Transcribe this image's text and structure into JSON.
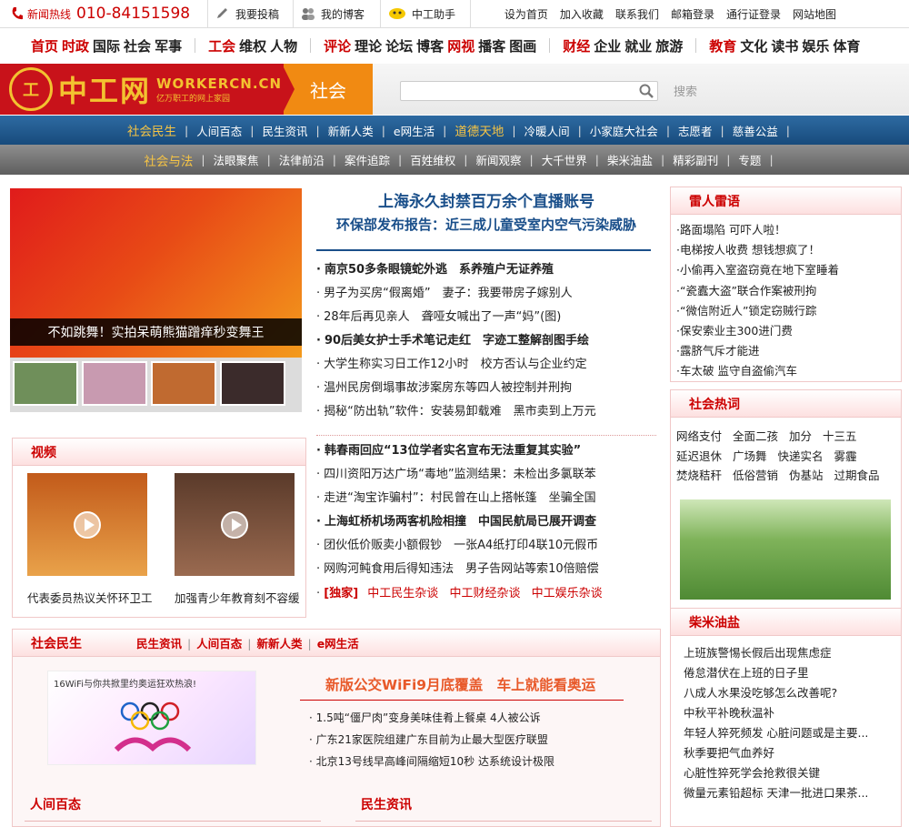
{
  "topbar": {
    "hotline_label": "新闻热线",
    "hotline_number": "010-84151598",
    "buttons": [
      {
        "label": "我要投稿",
        "icon": "pen-icon"
      },
      {
        "label": "我的博客",
        "icon": "people-icon"
      },
      {
        "label": "中工助手",
        "icon": "assistant-icon"
      }
    ],
    "links": [
      "设为首页",
      "加入收藏",
      "联系我们",
      "邮箱登录",
      "通行证登录",
      "网站地图"
    ]
  },
  "mainnav": {
    "groups": [
      [
        {
          "t": "首页",
          "red": true
        },
        {
          "t": "时政",
          "red": true
        },
        {
          "t": "国际",
          "red": false
        },
        {
          "t": "社会",
          "red": false
        },
        {
          "t": "军事",
          "red": false
        }
      ],
      [
        {
          "t": "工会",
          "red": true
        },
        {
          "t": "维权",
          "red": false
        },
        {
          "t": "人物",
          "red": false
        }
      ],
      [
        {
          "t": "评论",
          "red": true
        },
        {
          "t": "理论",
          "red": false
        },
        {
          "t": "论坛",
          "red": false
        },
        {
          "t": "博客",
          "red": false
        },
        {
          "t": "网视",
          "red": true
        },
        {
          "t": "播客",
          "red": false
        },
        {
          "t": "图画",
          "red": false
        }
      ],
      [
        {
          "t": "财经",
          "red": true
        },
        {
          "t": "企业",
          "red": false
        },
        {
          "t": "就业",
          "red": false
        },
        {
          "t": "旅游",
          "red": false
        }
      ],
      [
        {
          "t": "教育",
          "red": true
        },
        {
          "t": "文化",
          "red": false
        },
        {
          "t": "读书",
          "red": false
        },
        {
          "t": "娱乐",
          "red": false
        },
        {
          "t": "体育",
          "red": false
        }
      ]
    ]
  },
  "banner": {
    "logo_cn": "中工网",
    "logo_url": "WORKERCN.CN",
    "logo_slogan": "亿万职工的网上家园",
    "section": "社会",
    "search_placeholder": "",
    "search_button": "搜索"
  },
  "subnav1": [
    {
      "t": "社会民生",
      "hl": true
    },
    {
      "t": "人间百态",
      "hl": false
    },
    {
      "t": "民生资讯",
      "hl": false
    },
    {
      "t": "新新人类",
      "hl": false
    },
    {
      "t": "e网生活",
      "hl": false
    },
    {
      "t": "道德天地",
      "hl": true
    },
    {
      "t": "冷暖人间",
      "hl": false
    },
    {
      "t": "小家庭大社会",
      "hl": false
    },
    {
      "t": "志愿者",
      "hl": false
    },
    {
      "t": "慈善公益",
      "hl": false
    }
  ],
  "subnav2": [
    {
      "t": "社会与法",
      "hl": true
    },
    {
      "t": "法眼聚焦",
      "hl": false
    },
    {
      "t": "法律前沿",
      "hl": false
    },
    {
      "t": "案件追踪",
      "hl": false
    },
    {
      "t": "百姓维权",
      "hl": false
    },
    {
      "t": "新闻观察",
      "hl": false
    },
    {
      "t": "大千世界",
      "hl": false
    },
    {
      "t": "柴米油盐",
      "hl": false
    },
    {
      "t": "精彩副刊",
      "hl": false
    },
    {
      "t": "专题",
      "hl": false
    }
  ],
  "feature": {
    "caption": "不如跳舞！实拍呆萌熊猫蹭痒秒变舞王",
    "thumb_colors": [
      "#6f8f5a",
      "#c89ab0",
      "#c06a30",
      "#3b2b2b"
    ]
  },
  "video": {
    "title": "视频",
    "items": [
      {
        "caption": "代表委员热议关怀环卫工"
      },
      {
        "caption": "加强青少年教育刻不容缓"
      }
    ]
  },
  "center": {
    "headline1": "上海永久封禁百万余个直播账号",
    "headline2": "环保部发布报告：近三成儿童受室内空气污染威胁",
    "list1": [
      {
        "t": "南京50多条眼镜蛇外逃　系养殖户无证养殖",
        "b": true
      },
      {
        "t": "男子为买房“假离婚”　妻子：我要带房子嫁别人",
        "b": false
      },
      {
        "t": "28年后再见亲人　聋哑女喊出了一声“妈”(图)",
        "b": false
      },
      {
        "t": "90后美女护士手术笔记走红　字迹工整解剖图手绘",
        "b": true
      },
      {
        "t": "大学生称实习日工作12小时　校方否认与企业约定",
        "b": false
      },
      {
        "t": "温州民房倒塌事故涉案房东等四人被控制并刑拘",
        "b": false
      },
      {
        "t": "揭秘“防出轨”软件：安装易卸载难　黑市卖到上万元",
        "b": false
      }
    ],
    "list2": [
      {
        "t": "韩春雨回应“13位学者实名宣布无法重复其实验”",
        "b": true
      },
      {
        "t": "四川资阳万达广场“毒地”监测结果：未检出多氯联苯",
        "b": false
      },
      {
        "t": "走进“淘宝诈骗村”：村民曾在山上搭帐篷　坐骗全国",
        "b": false
      },
      {
        "t": "上海虹桥机场两客机险相撞　中国民航局已展开调查",
        "b": true
      },
      {
        "t": "团伙低价贩卖小额假钞　一张A4纸打印4联10元假币",
        "b": false
      },
      {
        "t": "网购河鲀食用后得知违法　男子告网站等索10倍赔偿",
        "b": false
      }
    ],
    "exclusive": {
      "tag": "[独家]",
      "items": [
        "中工民生杂谈",
        "中工财经杂谈",
        "中工娱乐杂谈"
      ]
    }
  },
  "leiren": {
    "title": "雷人雷语",
    "items": [
      "路面塌陷 可吓人啦！",
      "电梯按人收费 想钱想疯了！",
      "小偷再入室盗窃竟在地下室睡着",
      "“瓷蠹大盗”联合作案被刑拘",
      "“微信附近人”锁定窃贼行踪",
      "保安索业主300进门费",
      "露脐气斥才能进",
      "车太破 监守自盗偷汽车"
    ]
  },
  "rehot": {
    "title": "社会热词",
    "rows": [
      [
        "网络支付",
        "全面二孩",
        "加分",
        "十三五"
      ],
      [
        "延迟退休",
        "广场舞",
        "快递实名",
        "雾霾"
      ],
      [
        "焚烧秸秆",
        "低俗营销",
        "伪基站",
        "过期食品"
      ]
    ]
  },
  "chaimi": {
    "title": "柴米油盐",
    "items": [
      "上班族警惕长假后出现焦虑症",
      "倦怠潜伏在上班的日子里",
      "八成人水果没吃够怎么改善呢?",
      "中秋平补晚秋温补",
      "年轻人猝死频发 心脏问题或是主要...",
      "秋季要把气血养好",
      "心脏性猝死学会抢救很关键",
      "微量元素铅超标 天津一批进口果茶..."
    ]
  },
  "shehui": {
    "title": "社会民生",
    "links": [
      "民生资讯",
      "人间百态",
      "新新人类",
      "e网生活"
    ],
    "image_text": "16WiFi与你共掀里约奥运狂欢热浪!",
    "headline": "新版公交WiFi9月底覆盖　车上就能看奥运",
    "items": [
      "1.5吨“僵尸肉”变身美味佳肴上餐桌 4人被公诉",
      "广东21家医院组建广东目前为止最大型医疗联盟",
      "北京13号线早高峰间隔缩短10秒 达系统设计极限"
    ]
  },
  "bottom": {
    "left_title": "人间百态",
    "right_title": "民生资讯"
  }
}
